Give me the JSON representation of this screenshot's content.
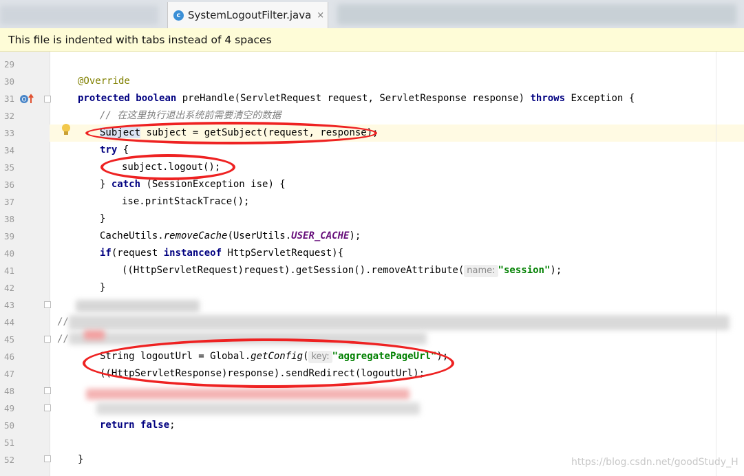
{
  "tab": {
    "filename": "SystemLogoutFilter.java",
    "close": "×",
    "icon": "c-class-icon"
  },
  "banner": {
    "message": "This file is indented with tabs instead of 4 spaces"
  },
  "lines": [
    "29",
    "30",
    "31",
    "32",
    "33",
    "34",
    "35",
    "36",
    "37",
    "38",
    "39",
    "40",
    "41",
    "42",
    "43",
    "44",
    "45",
    "46",
    "47",
    "48",
    "49",
    "50",
    "51",
    "52"
  ],
  "code": {
    "l30_annotation": "@Override",
    "l31_kw1": "protected",
    "l31_kw2": "boolean",
    "l31_sig": " preHandle(ServletRequest request, ServletResponse response) ",
    "l31_kw3": "throws",
    "l31_tail": " Exception {",
    "l32_comment": "// 在这里执行退出系统前需要清空的数据",
    "l33_type": "Subject",
    "l33_rest": " subject = getSubject(request, response);",
    "l34_try": "try",
    "l34_rest": " {",
    "l35": "subject.logout();",
    "l36_a": "} ",
    "l36_catch": "catch",
    "l36_b": " (SessionException ise) {",
    "l37": "ise.printStackTrace();",
    "l38": "}",
    "l39_a": "CacheUtils.",
    "l39_method": "removeCache",
    "l39_b": "(UserUtils.",
    "l39_const": "USER_CACHE",
    "l39_c": ");",
    "l40_if": "if",
    "l40_a": "(request ",
    "l40_instanceof": "instanceof",
    "l40_b": " HttpServletRequest){",
    "l41_a": "((HttpServletRequest)request).getSession().removeAttribute(",
    "l41_hint": "name:",
    "l41_str": "\"session\"",
    "l41_b": ");",
    "l42": "}",
    "l44_slash": "//",
    "l45_slash": "//",
    "l46_a": "String logoutUrl = Global.",
    "l46_method": "getConfig",
    "l46_b": "(",
    "l46_hint": "key:",
    "l46_str": "\"aggregatePageUrl\"",
    "l46_c": ");",
    "l47": "((HttpServletResponse)response).sendRedirect(logoutUrl);",
    "l50_return": "return",
    "l50_false": "false",
    "l50_semi": ";",
    "l52": "}"
  },
  "gutter_icons": {
    "override": "override-marker-icon",
    "bulb": "lightbulb-icon"
  },
  "watermark": "https://blog.csdn.net/goodStudy_H",
  "colors": {
    "keyword": "#000080",
    "annotation": "#808000",
    "string": "#008000",
    "static": "#660e7a",
    "annotation_oval": "#ee2222",
    "banner": "#fefcd7"
  }
}
